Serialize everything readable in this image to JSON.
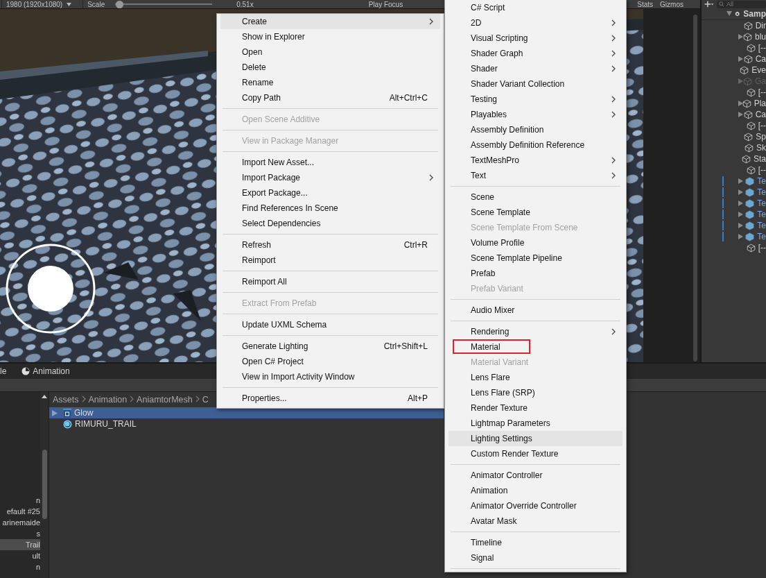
{
  "scene_toolbar": {
    "aspect": "1980 (1920x1080)",
    "scale_label": "Scale",
    "scale": {
      "level": 0.04,
      "reading": "0.51x"
    },
    "play_focus": "Play Focus",
    "stats": "Stats",
    "gizmos": "Gizmos"
  },
  "hierarchy": {
    "search_placeholder": "All",
    "root": {
      "label": "Samp",
      "expanded": true
    },
    "items": [
      {
        "label": "Dir",
        "kind": "object",
        "has_children": false,
        "disabled": false
      },
      {
        "label": "blu",
        "kind": "object",
        "has_children": true,
        "disabled": false
      },
      {
        "label": "[--",
        "kind": "object",
        "has_children": false,
        "disabled": false
      },
      {
        "label": "Ca",
        "kind": "object",
        "has_children": true,
        "disabled": false
      },
      {
        "label": "Eve",
        "kind": "object",
        "has_children": false,
        "disabled": false
      },
      {
        "label": "Ga",
        "kind": "object",
        "has_children": true,
        "disabled": true
      },
      {
        "label": "[--",
        "kind": "object",
        "has_children": false,
        "disabled": false
      },
      {
        "label": "Pla",
        "kind": "object",
        "has_children": true,
        "disabled": false
      },
      {
        "label": "Ca",
        "kind": "object",
        "has_children": true,
        "disabled": false
      },
      {
        "label": "[--",
        "kind": "object",
        "has_children": false,
        "disabled": false
      },
      {
        "label": "Sp",
        "kind": "object",
        "has_children": false,
        "disabled": false
      },
      {
        "label": "Sk",
        "kind": "object",
        "has_children": false,
        "disabled": false
      },
      {
        "label": "Sta",
        "kind": "object",
        "has_children": false,
        "disabled": false
      },
      {
        "label": "[--",
        "kind": "object",
        "has_children": false,
        "disabled": false
      },
      {
        "label": "Te",
        "kind": "prefab",
        "has_children": true,
        "disabled": false
      },
      {
        "label": "Te",
        "kind": "prefab",
        "has_children": true,
        "disabled": false
      },
      {
        "label": "Te",
        "kind": "prefab",
        "has_children": true,
        "disabled": false
      },
      {
        "label": "Te",
        "kind": "prefab",
        "has_children": true,
        "disabled": false
      },
      {
        "label": "Te",
        "kind": "prefab",
        "has_children": true,
        "disabled": false
      },
      {
        "label": "Te",
        "kind": "prefab",
        "has_children": true,
        "disabled": false
      },
      {
        "label": "[--",
        "kind": "object",
        "has_children": false,
        "disabled": false
      }
    ]
  },
  "bottom_tabs": [
    {
      "label": "le",
      "kind": "plain"
    },
    {
      "label": "Animation",
      "kind": "clock"
    }
  ],
  "folder_tree": [
    {
      "label": "n",
      "selected": false
    },
    {
      "label": "efault #25",
      "selected": false
    },
    {
      "label": "arinemaide",
      "selected": false
    },
    {
      "label": "s",
      "selected": false
    },
    {
      "label": "Trail",
      "selected": true
    },
    {
      "label": "ult",
      "selected": false
    },
    {
      "label": "n",
      "selected": false
    }
  ],
  "breadcrumb": [
    "Assets",
    "Animation",
    "AniamtorMesh",
    "C"
  ],
  "assets": [
    {
      "name": "Glow",
      "kind": "prefab",
      "selected": true,
      "expandable": true
    },
    {
      "name": "RIMURU_TRAIL",
      "kind": "material",
      "selected": false,
      "expandable": false
    }
  ],
  "context_menu": {
    "items": [
      {
        "kind": "item",
        "label": "Create",
        "submenu": true,
        "disabled": false,
        "selected": true
      },
      {
        "kind": "item",
        "label": "Show in Explorer",
        "submenu": false,
        "disabled": false,
        "selected": false
      },
      {
        "kind": "item",
        "label": "Open",
        "submenu": false,
        "disabled": false,
        "selected": false
      },
      {
        "kind": "item",
        "label": "Delete",
        "submenu": false,
        "disabled": false,
        "selected": false
      },
      {
        "kind": "item",
        "label": "Rename",
        "submenu": false,
        "disabled": false,
        "selected": false
      },
      {
        "kind": "item",
        "label": "Copy Path",
        "shortcut": "Alt+Ctrl+C",
        "submenu": false,
        "disabled": false,
        "selected": false
      },
      {
        "kind": "separator"
      },
      {
        "kind": "item",
        "label": "Open Scene Additive",
        "submenu": false,
        "disabled": true,
        "selected": false
      },
      {
        "kind": "separator"
      },
      {
        "kind": "item",
        "label": "View in Package Manager",
        "submenu": false,
        "disabled": true,
        "selected": false
      },
      {
        "kind": "separator"
      },
      {
        "kind": "item",
        "label": "Import New Asset...",
        "submenu": false,
        "disabled": false,
        "selected": false
      },
      {
        "kind": "item",
        "label": "Import Package",
        "submenu": true,
        "disabled": false,
        "selected": false
      },
      {
        "kind": "item",
        "label": "Export Package...",
        "submenu": false,
        "disabled": false,
        "selected": false
      },
      {
        "kind": "item",
        "label": "Find References In Scene",
        "submenu": false,
        "disabled": false,
        "selected": false
      },
      {
        "kind": "item",
        "label": "Select Dependencies",
        "submenu": false,
        "disabled": false,
        "selected": false
      },
      {
        "kind": "separator"
      },
      {
        "kind": "item",
        "label": "Refresh",
        "shortcut": "Ctrl+R",
        "submenu": false,
        "disabled": false,
        "selected": false
      },
      {
        "kind": "item",
        "label": "Reimport",
        "submenu": false,
        "disabled": false,
        "selected": false
      },
      {
        "kind": "separator"
      },
      {
        "kind": "item",
        "label": "Reimport All",
        "submenu": false,
        "disabled": false,
        "selected": false
      },
      {
        "kind": "separator"
      },
      {
        "kind": "item",
        "label": "Extract From Prefab",
        "submenu": false,
        "disabled": true,
        "selected": false
      },
      {
        "kind": "separator"
      },
      {
        "kind": "item",
        "label": "Update UXML Schema",
        "submenu": false,
        "disabled": false,
        "selected": false
      },
      {
        "kind": "separator"
      },
      {
        "kind": "item",
        "label": "Generate Lighting",
        "shortcut": "Ctrl+Shift+L",
        "submenu": false,
        "disabled": false,
        "selected": false
      },
      {
        "kind": "item",
        "label": "Open C# Project",
        "submenu": false,
        "disabled": false,
        "selected": false
      },
      {
        "kind": "item",
        "label": "View in Import Activity Window",
        "submenu": false,
        "disabled": false,
        "selected": false
      },
      {
        "kind": "separator"
      },
      {
        "kind": "item",
        "label": "Properties...",
        "shortcut": "Alt+P",
        "submenu": false,
        "disabled": false,
        "selected": false
      }
    ]
  },
  "create_submenu": {
    "items": [
      {
        "kind": "item",
        "label": "C# Script",
        "submenu": false,
        "disabled": false,
        "selected": false,
        "outlined": false
      },
      {
        "kind": "item",
        "label": "2D",
        "submenu": true,
        "disabled": false,
        "selected": false,
        "outlined": false
      },
      {
        "kind": "item",
        "label": "Visual Scripting",
        "submenu": true,
        "disabled": false,
        "selected": false,
        "outlined": false
      },
      {
        "kind": "item",
        "label": "Shader Graph",
        "submenu": true,
        "disabled": false,
        "selected": false,
        "outlined": false
      },
      {
        "kind": "item",
        "label": "Shader",
        "submenu": true,
        "disabled": false,
        "selected": false,
        "outlined": false
      },
      {
        "kind": "item",
        "label": "Shader Variant Collection",
        "submenu": false,
        "disabled": false,
        "selected": false,
        "outlined": false
      },
      {
        "kind": "item",
        "label": "Testing",
        "submenu": true,
        "disabled": false,
        "selected": false,
        "outlined": false
      },
      {
        "kind": "item",
        "label": "Playables",
        "submenu": true,
        "disabled": false,
        "selected": false,
        "outlined": false
      },
      {
        "kind": "item",
        "label": "Assembly Definition",
        "submenu": false,
        "disabled": false,
        "selected": false,
        "outlined": false
      },
      {
        "kind": "item",
        "label": "Assembly Definition Reference",
        "submenu": false,
        "disabled": false,
        "selected": false,
        "outlined": false
      },
      {
        "kind": "item",
        "label": "TextMeshPro",
        "submenu": true,
        "disabled": false,
        "selected": false,
        "outlined": false
      },
      {
        "kind": "item",
        "label": "Text",
        "submenu": true,
        "disabled": false,
        "selected": false,
        "outlined": false
      },
      {
        "kind": "separator"
      },
      {
        "kind": "item",
        "label": "Scene",
        "submenu": false,
        "disabled": false,
        "selected": false,
        "outlined": false
      },
      {
        "kind": "item",
        "label": "Scene Template",
        "submenu": false,
        "disabled": false,
        "selected": false,
        "outlined": false
      },
      {
        "kind": "item",
        "label": "Scene Template From Scene",
        "submenu": false,
        "disabled": true,
        "selected": false,
        "outlined": false
      },
      {
        "kind": "item",
        "label": "Volume Profile",
        "submenu": false,
        "disabled": false,
        "selected": false,
        "outlined": false
      },
      {
        "kind": "item",
        "label": "Scene Template Pipeline",
        "submenu": false,
        "disabled": false,
        "selected": false,
        "outlined": false
      },
      {
        "kind": "item",
        "label": "Prefab",
        "submenu": false,
        "disabled": false,
        "selected": false,
        "outlined": false
      },
      {
        "kind": "item",
        "label": "Prefab Variant",
        "submenu": false,
        "disabled": true,
        "selected": false,
        "outlined": false
      },
      {
        "kind": "separator"
      },
      {
        "kind": "item",
        "label": "Audio Mixer",
        "submenu": false,
        "disabled": false,
        "selected": false,
        "outlined": false
      },
      {
        "kind": "separator"
      },
      {
        "kind": "item",
        "label": "Rendering",
        "submenu": true,
        "disabled": false,
        "selected": false,
        "outlined": false
      },
      {
        "kind": "item",
        "label": "Material",
        "submenu": false,
        "disabled": false,
        "selected": false,
        "outlined": true
      },
      {
        "kind": "item",
        "label": "Material Variant",
        "submenu": false,
        "disabled": true,
        "selected": false,
        "outlined": false
      },
      {
        "kind": "item",
        "label": "Lens Flare",
        "submenu": false,
        "disabled": false,
        "selected": false,
        "outlined": false
      },
      {
        "kind": "item",
        "label": "Lens Flare (SRP)",
        "submenu": false,
        "disabled": false,
        "selected": false,
        "outlined": false
      },
      {
        "kind": "item",
        "label": "Render Texture",
        "submenu": false,
        "disabled": false,
        "selected": false,
        "outlined": false
      },
      {
        "kind": "item",
        "label": "Lightmap Parameters",
        "submenu": false,
        "disabled": false,
        "selected": false,
        "outlined": false
      },
      {
        "kind": "item",
        "label": "Lighting Settings",
        "submenu": false,
        "disabled": false,
        "selected": true,
        "outlined": false
      },
      {
        "kind": "item",
        "label": "Custom Render Texture",
        "submenu": false,
        "disabled": false,
        "selected": false,
        "outlined": false
      },
      {
        "kind": "separator"
      },
      {
        "kind": "item",
        "label": "Animator Controller",
        "submenu": false,
        "disabled": false,
        "selected": false,
        "outlined": false
      },
      {
        "kind": "item",
        "label": "Animation",
        "submenu": false,
        "disabled": false,
        "selected": false,
        "outlined": false
      },
      {
        "kind": "item",
        "label": "Animator Override Controller",
        "submenu": false,
        "disabled": false,
        "selected": false,
        "outlined": false
      },
      {
        "kind": "item",
        "label": "Avatar Mask",
        "submenu": false,
        "disabled": false,
        "selected": false,
        "outlined": false
      },
      {
        "kind": "separator"
      },
      {
        "kind": "item",
        "label": "Timeline",
        "submenu": false,
        "disabled": false,
        "selected": false,
        "outlined": false
      },
      {
        "kind": "item",
        "label": "Signal",
        "submenu": false,
        "disabled": false,
        "selected": false,
        "outlined": false
      },
      {
        "kind": "separator"
      }
    ]
  }
}
